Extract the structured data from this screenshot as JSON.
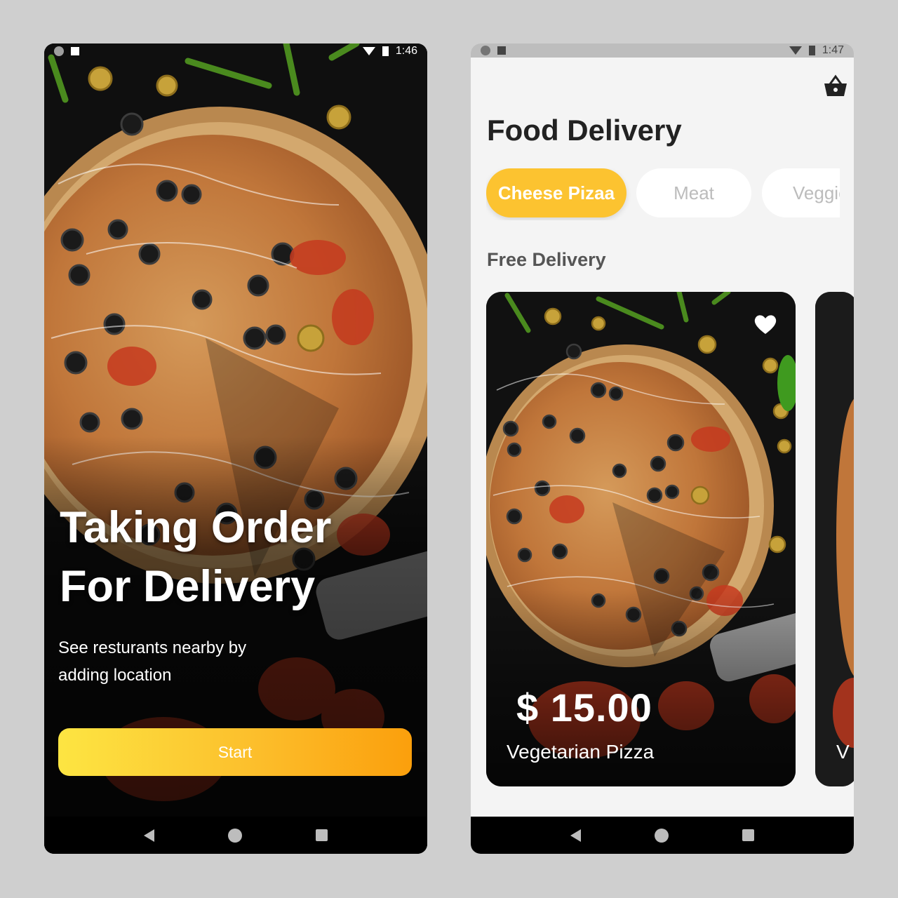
{
  "screen1": {
    "status_time": "1:46",
    "headline_line1": "Taking Order",
    "headline_line2": "For Delivery",
    "subtext_line1": "See resturants nearby by",
    "subtext_line2": "adding location",
    "start_label": "Start",
    "colors": {
      "button_gradient_start": "#fde542",
      "button_gradient_end": "#fb9f0c"
    }
  },
  "screen2": {
    "status_time": "1:47",
    "cart_icon": "basket-icon",
    "title": "Food Delivery",
    "chips": [
      {
        "label": "Cheese Pizaa",
        "active": true
      },
      {
        "label": "Meat",
        "active": false
      },
      {
        "label": "Veggie",
        "active": false
      }
    ],
    "section_title": "Free Delivery",
    "card": {
      "price": "$  15.00",
      "name": "Vegetarian Pizza",
      "favorite_icon": "heart-icon"
    },
    "peek_card_initial": "V",
    "colors": {
      "accent": "#fcc330",
      "background": "#f4f4f4"
    }
  },
  "nav_icons": [
    "back-icon",
    "home-icon",
    "recents-icon"
  ]
}
